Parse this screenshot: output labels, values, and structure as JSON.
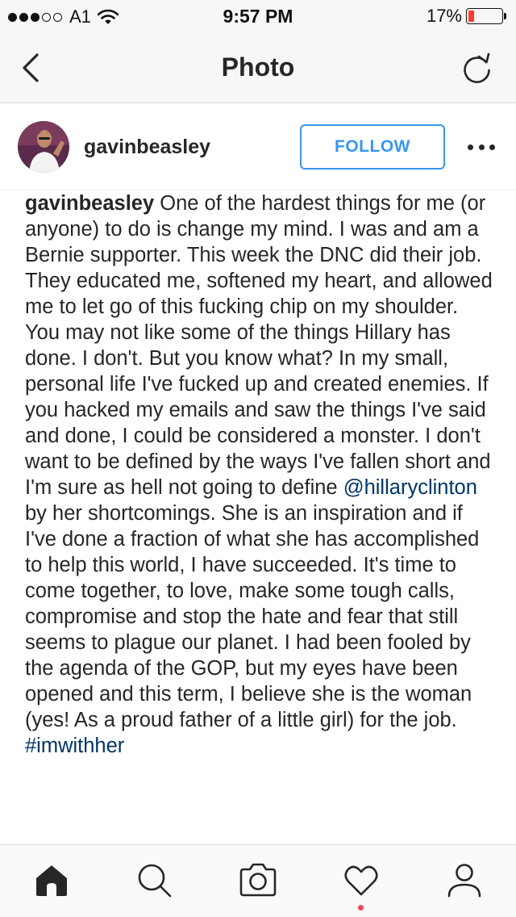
{
  "status_bar": {
    "carrier": "A1",
    "time": "9:57 PM",
    "battery_percent_label": "17%",
    "battery_level": 0.17,
    "signal_bars_filled": 3,
    "signal_bars_total": 5
  },
  "nav": {
    "title": "Photo",
    "back_icon": "chevron-left-icon",
    "refresh_icon": "refresh-icon"
  },
  "post": {
    "username": "gavinbeasley",
    "follow_label": "FOLLOW",
    "more_icon": "more-dots-icon",
    "caption": {
      "author": "gavinbeasley",
      "text_1": " One of the hardest things for me (or anyone) to do is change my mind. I was and am a Bernie supporter. This week the DNC did their job. They educated me, softened my heart, and allowed me to let go of this fucking chip on my shoulder. You may not like some of the things Hillary has done. I don't. But you know what? In my small, personal life I've fucked up and created enemies. If you hacked my emails and saw the things I've said and done, I could be considered a monster. I don't want to be defined by the ways I've fallen short and I'm sure as hell not going to define ",
      "mention": "@hillaryclinton",
      "text_2": " by her shortcomings. She is an inspiration and if I've done a fraction of what she has accomplished to help this world, I have succeeded. It's time to come together, to love, make some tough calls, compromise and stop the hate and fear that still seems to plague our planet. I had been fooled by the agenda of the GOP, but my eyes have been opened and this term, I believe she is the woman (yes! As a proud father of a little girl) for the job. ",
      "hashtag": "#imwithher"
    }
  },
  "tab_bar": {
    "tabs": [
      "home-icon",
      "search-icon",
      "camera-icon",
      "heart-icon",
      "profile-icon"
    ],
    "active_tab": "home-icon",
    "activity_indicator": true
  },
  "colors": {
    "follow_blue": "#3897f0",
    "link": "#003569",
    "battery_low": "#ff3b30",
    "notification": "#ed4956"
  }
}
